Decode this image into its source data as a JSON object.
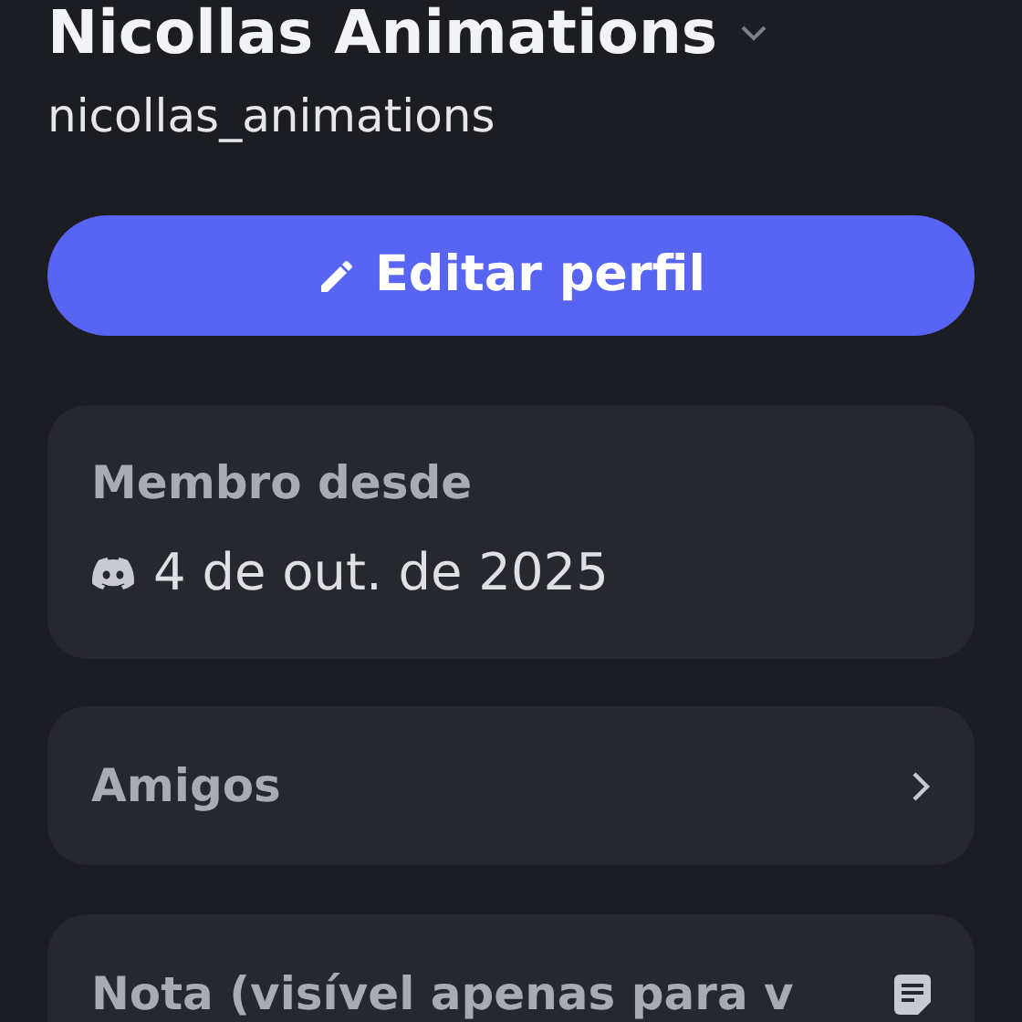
{
  "profile": {
    "display_name": "Nicollas Animations",
    "username": "nicollas_animations"
  },
  "edit_button": {
    "label": "Editar perfil"
  },
  "member_since": {
    "label": "Membro desde",
    "date": "4 de out. de 2025"
  },
  "rows": [
    {
      "kind": "link",
      "label": "Amigos"
    },
    {
      "kind": "note",
      "label": "Nota (visível apenas para v"
    }
  ]
}
